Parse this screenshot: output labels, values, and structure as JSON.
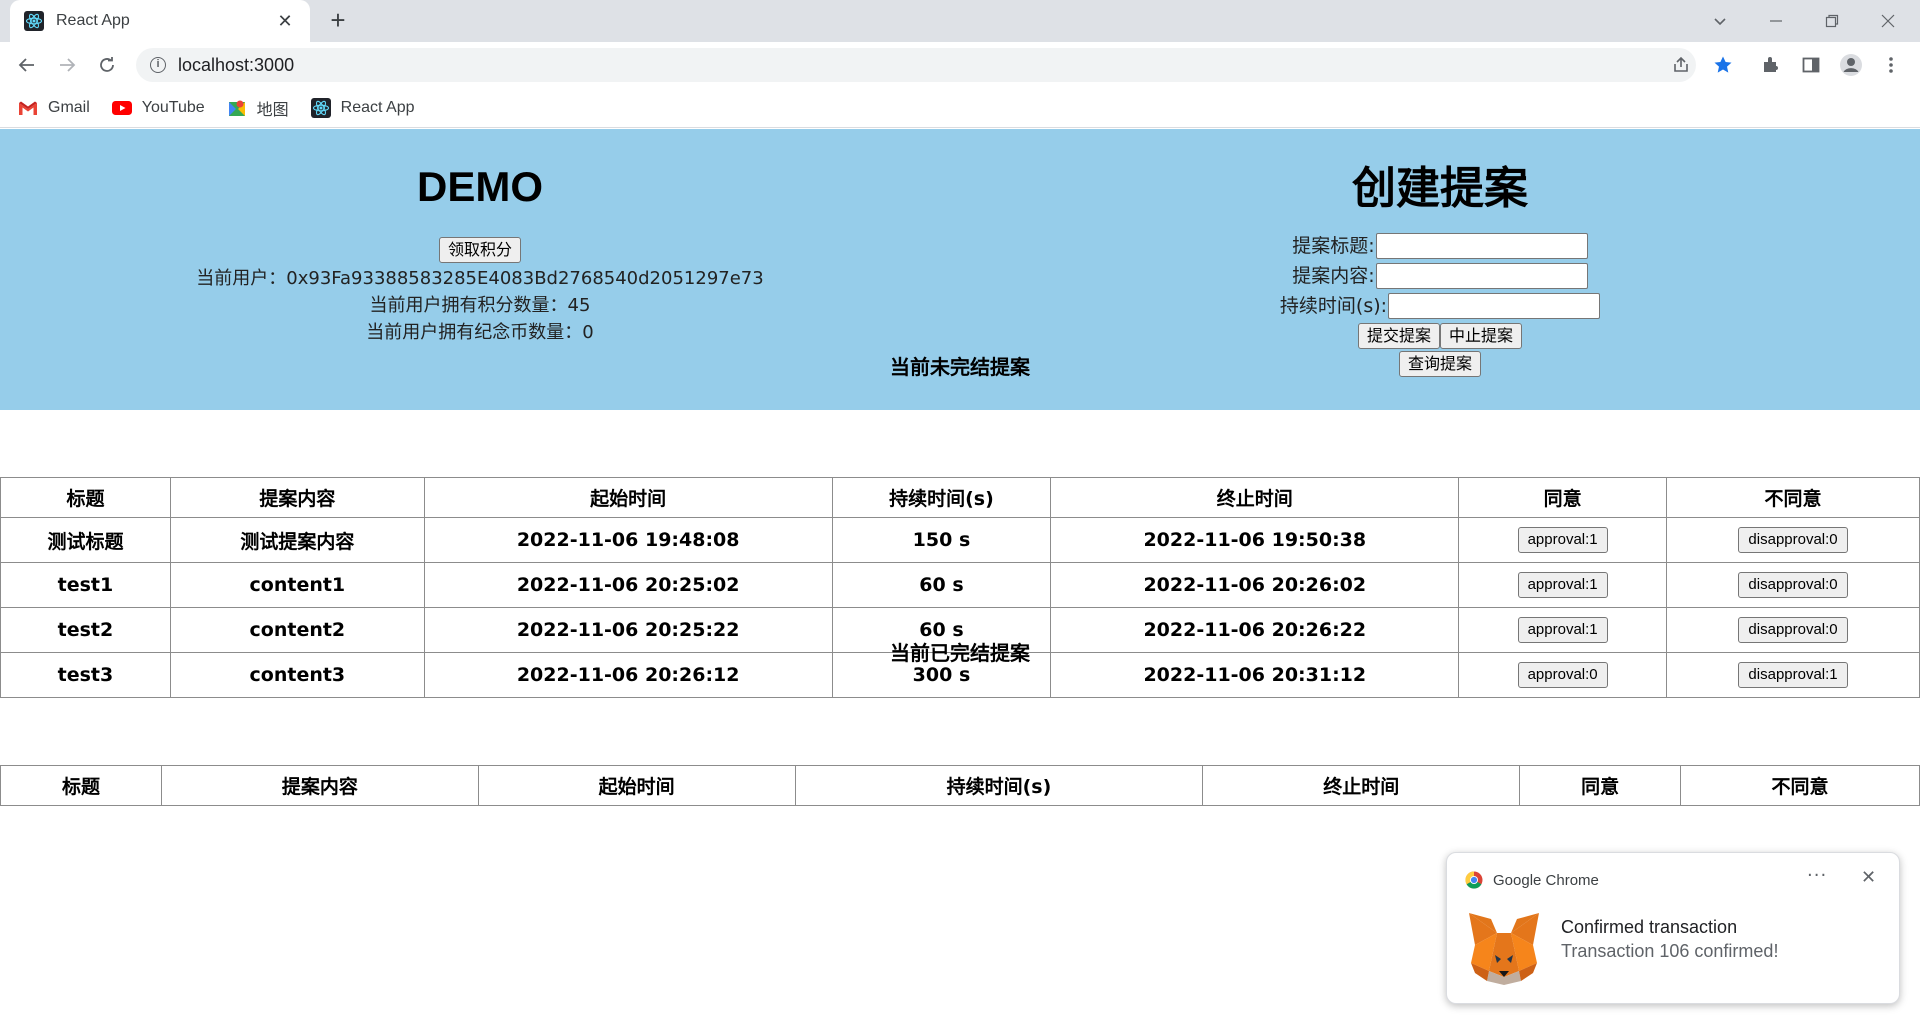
{
  "browser": {
    "tab_title": "React App",
    "url": "localhost:3000",
    "bookmarks": [
      {
        "label": "Gmail",
        "icon": "gmail-icon"
      },
      {
        "label": "YouTube",
        "icon": "youtube-icon"
      },
      {
        "label": "地图",
        "icon": "maps-icon"
      },
      {
        "label": "React App",
        "icon": "react-icon"
      }
    ]
  },
  "demo": {
    "title": "DEMO",
    "claim_button": "领取积分",
    "current_user": "当前用户：0x93Fa93388583285E4083Bd2768540d2051297e73",
    "points": "当前用户拥有积分数量：45",
    "coins": "当前用户拥有纪念币数量：0"
  },
  "create": {
    "title": "创建提案",
    "title_label": "提案标题:",
    "content_label": "提案内容:",
    "duration_label": "持续时间(s):",
    "title_value": "",
    "content_value": "",
    "duration_value": "",
    "submit_button": "提交提案",
    "stop_button": "中止提案",
    "query_button": "查询提案"
  },
  "ongoing": {
    "heading": "当前未完结提案",
    "columns": [
      "标题",
      "提案内容",
      "起始时间",
      "持续时间(s)",
      "终止时间",
      "同意",
      "不同意"
    ],
    "rows": [
      {
        "title": "测试标题",
        "content": "测试提案内容",
        "start": "2022-11-06 19:48:08",
        "duration": "150 s",
        "end": "2022-11-06 19:50:38",
        "approval": "approval:1",
        "disapproval": "disapproval:0"
      },
      {
        "title": "test1",
        "content": "content1",
        "start": "2022-11-06 20:25:02",
        "duration": "60 s",
        "end": "2022-11-06 20:26:02",
        "approval": "approval:1",
        "disapproval": "disapproval:0"
      },
      {
        "title": "test2",
        "content": "content2",
        "start": "2022-11-06 20:25:22",
        "duration": "60 s",
        "end": "2022-11-06 20:26:22",
        "approval": "approval:1",
        "disapproval": "disapproval:0"
      },
      {
        "title": "test3",
        "content": "content3",
        "start": "2022-11-06 20:26:12",
        "duration": "300 s",
        "end": "2022-11-06 20:31:12",
        "approval": "approval:0",
        "disapproval": "disapproval:1"
      }
    ]
  },
  "finished": {
    "heading": "当前已完结提案",
    "columns": [
      "标题",
      "提案内容",
      "起始时间",
      "持续时间(s)",
      "终止时间",
      "同意",
      "不同意"
    ]
  },
  "notification": {
    "app": "Google Chrome",
    "title": "Confirmed transaction",
    "body": "Transaction 106 confirmed!",
    "more": "···"
  },
  "colors": {
    "hero_bg": "#96cdea",
    "tabstrip_bg": "#dee1e6"
  }
}
